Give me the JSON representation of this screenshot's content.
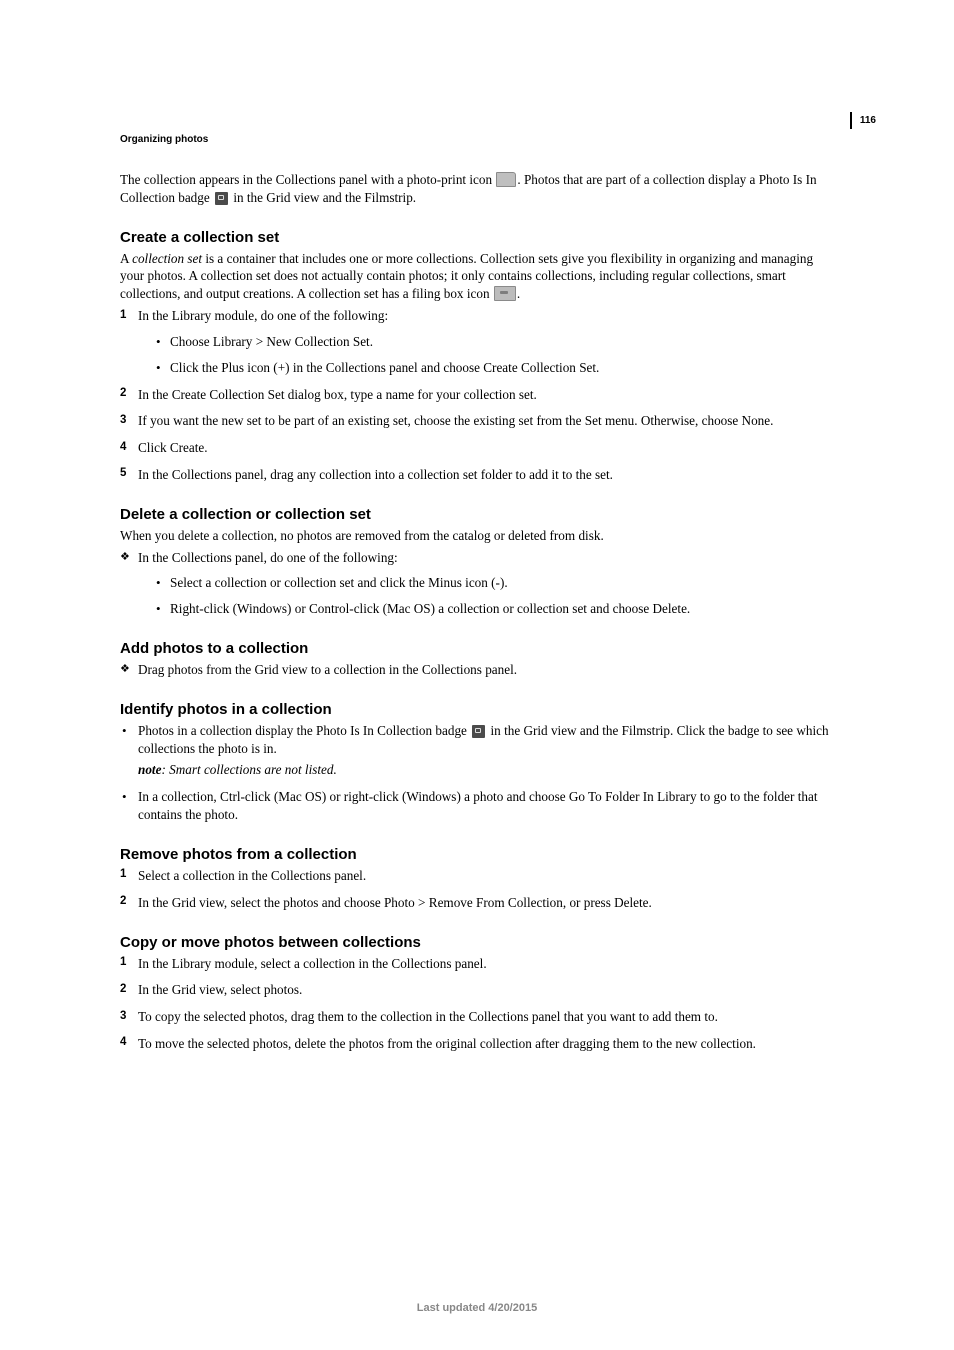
{
  "header": {
    "section": "Organizing photos",
    "page_number": "116"
  },
  "intro": {
    "line1a": "The collection appears in the Collections panel with a photo-print icon ",
    "line1b": ". Photos that are part of a collection display a Photo Is In Collection badge ",
    "line1c": " in the Grid view and the Filmstrip."
  },
  "s1": {
    "title": "Create a collection set",
    "desc_a": "A ",
    "desc_term": "collection set",
    "desc_b": " is a container that includes one or more collections. Collection sets give you flexibility in organizing and managing your photos. A collection set does not actually contain photos; it only contains collections, including regular collections, smart collections, and output creations. A collection set has a filing box icon ",
    "desc_c": ".",
    "step1": "In the Library module, do one of the following:",
    "step1a": "Choose Library > New Collection Set.",
    "step1b": "Click the Plus icon (+) in the Collections panel and choose Create Collection Set.",
    "step2": "In the Create Collection Set dialog box, type a name for your collection set.",
    "step3": "If you want the new set to be part of an existing set, choose the existing set from the Set menu. Otherwise, choose None.",
    "step4": "Click Create.",
    "step5": "In the Collections panel, drag any collection into a collection set folder to add it to the set."
  },
  "s2": {
    "title": "Delete a collection or collection set",
    "desc": "When you delete a collection, no photos are removed from the catalog or deleted from disk.",
    "d1": "In the Collections panel, do one of the following:",
    "d1a": "Select a collection or collection set and click the Minus icon (-).",
    "d1b": "Right-click (Windows) or Control-click (Mac OS) a collection or collection set and choose Delete."
  },
  "s3": {
    "title": "Add photos to a collection",
    "d1": "Drag photos from the Grid view to a collection in the Collections panel."
  },
  "s4": {
    "title": "Identify photos in a collection",
    "b1a": "Photos in a collection display the Photo Is In Collection badge ",
    "b1b": " in the Grid view and the Filmstrip. Click the badge to see which collections the photo is in.",
    "note_label": "note",
    "note_text": ": Smart collections are not listed.",
    "b2": "In a collection, Ctrl-click (Mac OS) or right-click (Windows) a photo and choose Go To Folder In Library to go to the folder that contains the photo."
  },
  "s5": {
    "title": "Remove photos from a collection",
    "step1": "Select a collection in the Collections panel.",
    "step2": "In the Grid view, select the photos and choose Photo > Remove From Collection, or press Delete."
  },
  "s6": {
    "title": "Copy or move photos between collections",
    "step1": "In the Library module, select a collection in the Collections panel.",
    "step2": "In the Grid view, select photos.",
    "step3": "To copy the selected photos, drag them to the collection in the Collections panel that you want to add them to.",
    "step4": "To move the selected photos, delete the photos from the original collection after dragging them to the new collection."
  },
  "footer": {
    "text": "Last updated 4/20/2015"
  }
}
